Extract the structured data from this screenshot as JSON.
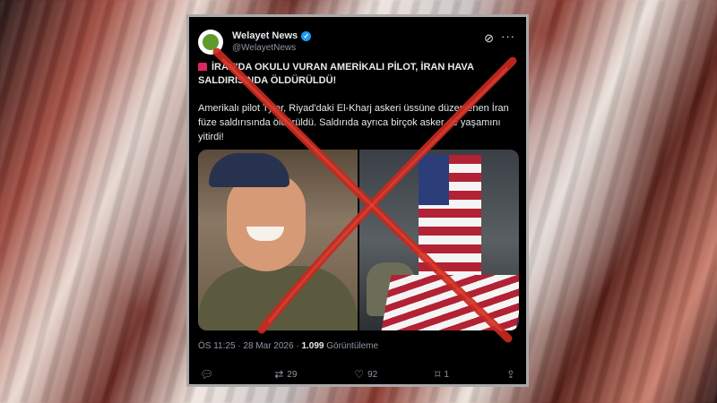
{
  "account": {
    "name": "Welayet News",
    "handle": "@WelayetNews"
  },
  "icons": {
    "verified": "verified-badge-icon",
    "grok": "grok-icon",
    "more": "more-icon",
    "siren": "siren-icon",
    "reply": "reply-icon",
    "retweet": "retweet-icon",
    "like": "heart-icon",
    "bookmark": "bookmark-icon",
    "share": "share-icon"
  },
  "tweet": {
    "headline": "İRAN'DA OKULU VURAN AMERİKALI PİLOT, İRAN HAVA SALDIRISINDA ÖLDÜRÜLDÜ!",
    "body": "Amerikalı pilot Tyler, Riyad'daki El-Kharj askeri üssüne düzenlenen İran füze saldırısında öldürüldü. Saldırıda ayrıca birçok asker de yaşamını yitirdi!",
    "timestamp": "ÖS 11:25 · 28 Mar 2026 ·",
    "views_count": "1.099",
    "views_label": "Görüntüleme"
  },
  "actions": {
    "reply_count": "",
    "retweet_count": "29",
    "like_count": "92",
    "bookmark_count": "1"
  },
  "colors": {
    "accent_blue": "#1d9bf0",
    "cross_red": "#c8281e",
    "card_bg": "#000000"
  }
}
